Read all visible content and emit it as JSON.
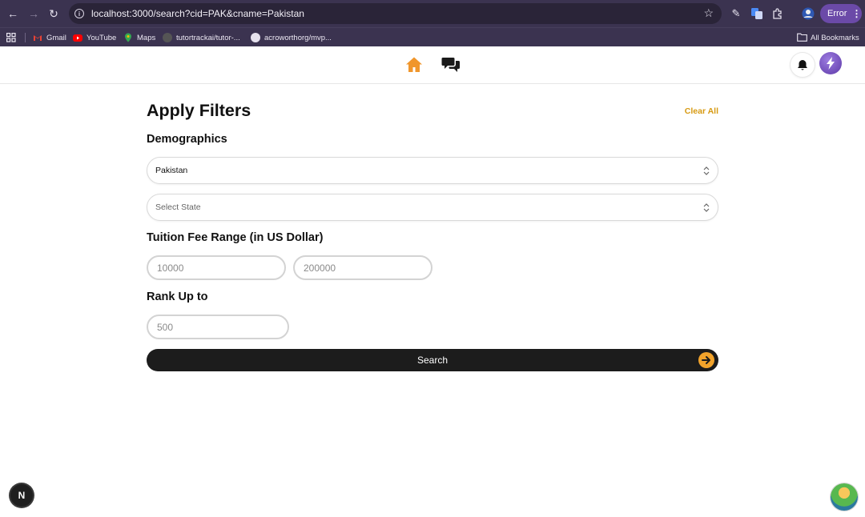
{
  "browser": {
    "url": "localhost:3000/search?cid=PAK&cname=Pakistan",
    "profile_status": "Error",
    "bookmarks": [
      {
        "label": "Gmail",
        "color": "#ea4335"
      },
      {
        "label": "YouTube",
        "color": "#ff0000"
      },
      {
        "label": "Maps",
        "color": "#34a853"
      },
      {
        "label": "tutortrackai/tutor-...",
        "color": "#6e6e6e"
      },
      {
        "label": "acroworthorg/mvp...",
        "color": "#e6e2ee"
      }
    ],
    "all_bookmarks": "All Bookmarks"
  },
  "header": {
    "home_color": "#f0962c",
    "icons": [
      "home-icon",
      "chat-icon",
      "bell-icon",
      "avatar"
    ]
  },
  "filters": {
    "title": "Apply Filters",
    "clear_all": "Clear All",
    "demographics": {
      "heading": "Demographics",
      "country_value": "Pakistan",
      "state_placeholder": "Select State"
    },
    "tuition": {
      "heading": "Tuition Fee Range (in US Dollar)",
      "min_placeholder": "10000",
      "max_placeholder": "200000"
    },
    "rank": {
      "heading": "Rank Up to",
      "placeholder": "500"
    },
    "search_label": "Search",
    "accent": "#f2a32b"
  },
  "badge": {
    "letter": "N"
  }
}
